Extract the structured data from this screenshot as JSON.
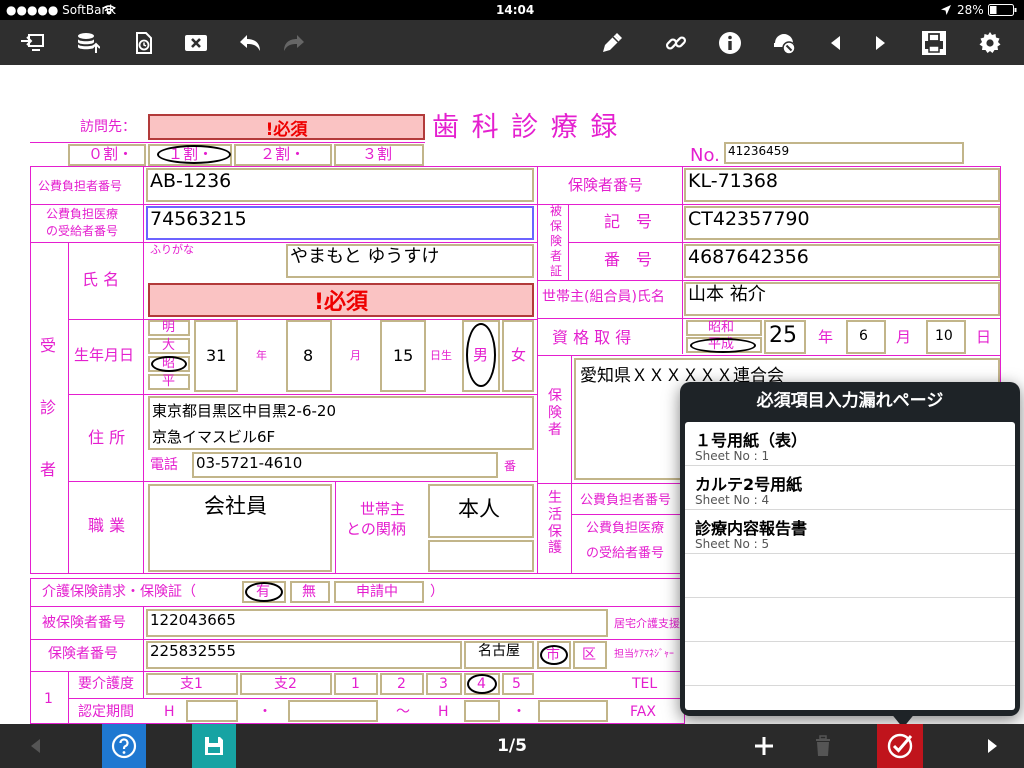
{
  "status_bar": {
    "carrier": "●●●●● SoftBank",
    "time": "14:04",
    "battery": "28%"
  },
  "toolbar": {
    "icons": [
      "import-icon",
      "database-upload-icon",
      "history-icon",
      "clear-icon",
      "undo-icon",
      "redo-icon",
      "pen-icon",
      "link-icon",
      "info-icon",
      "stamp-icon",
      "previous-icon",
      "next-icon",
      "print-icon",
      "settings-icon"
    ]
  },
  "form": {
    "title": "歯 科 診 療 録",
    "visit_label": "訪問先：",
    "visit_value": "!必須",
    "ratio": [
      "０割・",
      "１割・",
      "２割・",
      "３割"
    ],
    "no_label": "No.",
    "no_value": "41236459",
    "public_payer_label": "公費負担者番号",
    "public_payer_value": "AB-1236",
    "insurer_no_label": "保険者番号",
    "insurer_no_value": "KL-71368",
    "public_recipient_label_1": "公費負担医療",
    "public_recipient_label_2": "の受給者番号",
    "public_recipient_value": "74563215",
    "insured_vertical": "被保険者証",
    "symbol_label": "記　号",
    "symbol_value": "CT42357790",
    "number_label": "番　号",
    "number_value": "4687642356",
    "furigana_label": "ふりがな",
    "furigana_value": "やまもと ゆうすけ",
    "name_label": "氏 名",
    "name_value": "!必須",
    "patient_vertical": [
      "受",
      "診",
      "者"
    ],
    "householder_label": "世帯主(組合員)氏名",
    "householder_value": "山本 祐介",
    "dob_label": "生年月日",
    "eras": [
      "明",
      "大",
      "昭",
      "平"
    ],
    "dob_year": "31",
    "year_label": "年",
    "dob_month": "8",
    "month_label": "月",
    "dob_day": "15",
    "day_label": "日生",
    "male": "男",
    "female": "女",
    "qual_label": "資 格 取 得",
    "qual_era_1": "昭和",
    "qual_era_2": "平成",
    "qual_year": "25",
    "qual_year_label": "年",
    "qual_month": "6",
    "qual_month_label": "月",
    "qual_day": "10",
    "qual_day_label": "日",
    "insurer_vertical": "保険者",
    "insurer_name": "愛知県ＸＸＸＸＸＸ連合会",
    "address_label": "住 所",
    "address_1": "東京都目黒区中目黒2-6-20",
    "address_2": "京急イマスビル6F",
    "phone_label": "電話",
    "phone_value": "03-5721-4610",
    "ban_label": "番",
    "job_label": "職 業",
    "job_value": "会社員",
    "relation_label_1": "世帯主",
    "relation_label_2": "との関柄",
    "relation_value": "本人",
    "welfare_vertical": "生活保護",
    "welfare_payer_label": "公費負担者番号",
    "welfare_recipient_label_1": "公費負担医療",
    "welfare_recipient_label_2": "の受給者番号",
    "care_label": "介護保険請求・保険証（",
    "care_options": [
      "有",
      "無",
      "申請中"
    ],
    "care_close": "）",
    "care_insured_label": "被保険者番号",
    "care_insured_value": "122043665",
    "care_home_label": "居宅介護支援",
    "care_insurer_label": "保険者番号",
    "care_insurer_value": "225832555",
    "city_value": "名古屋",
    "city_opts": [
      "市",
      "区"
    ],
    "care_manager_label": "担当ｹｱﾏﾈｼﾞｬｰ",
    "row_number": "1",
    "care_level_label": "要介護度",
    "care_levels": [
      "支1",
      "支2",
      "1",
      "2",
      "3",
      "4",
      "5"
    ],
    "tel_label": "TEL",
    "cert_label": "認定期間",
    "cert_h": "H",
    "cert_dot": "・",
    "cert_tilde": "～",
    "fax_label": "FAX"
  },
  "popover": {
    "title": "必須項目入力漏れページ",
    "items": [
      {
        "title": "１号用紙（表）",
        "sub": "Sheet No : 1"
      },
      {
        "title": "カルテ2号用紙",
        "sub": "Sheet No : 4"
      },
      {
        "title": "診療内容報告書",
        "sub": "Sheet No : 5"
      }
    ]
  },
  "bottom_bar": {
    "page": "1/5"
  },
  "colors": {
    "form_line": "#e41fcf",
    "input_border": "#c2b58a",
    "required_fill": "#fac3c3",
    "check_button": "#c0141c",
    "help_button": "#1f78d1",
    "save_button": "#17a3a3"
  }
}
